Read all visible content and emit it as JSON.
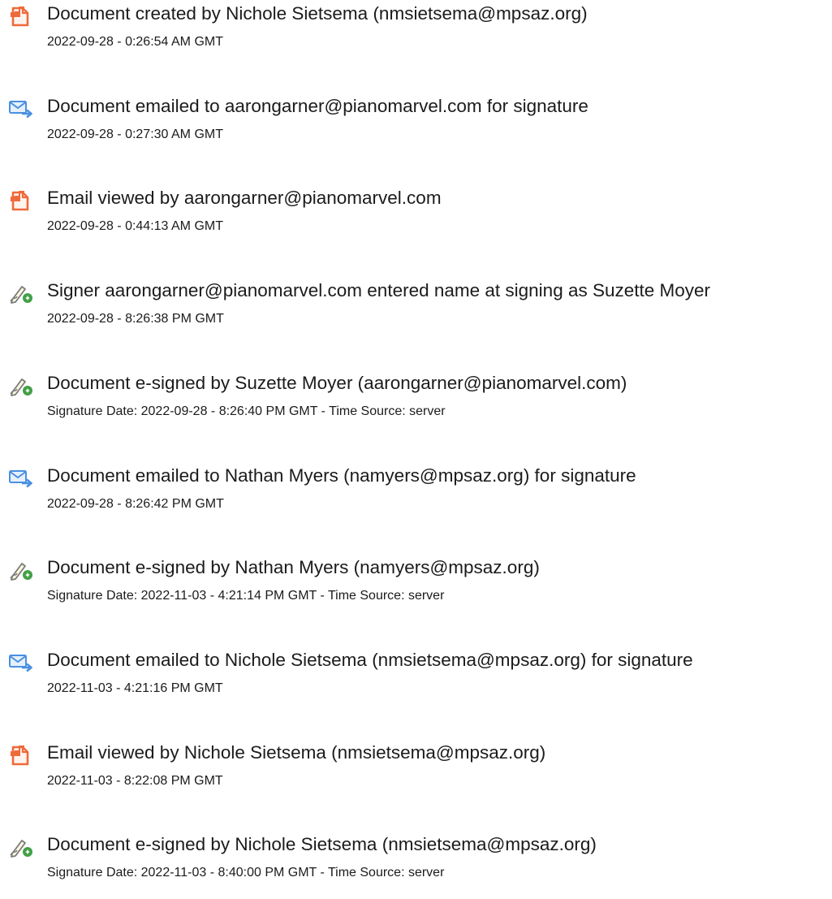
{
  "events": [
    {
      "icon": "document-created-icon",
      "title": "Document created by Nichole Sietsema (nmsietsema@mpsaz.org)",
      "time": "2022-09-28 - 0:26:54 AM GMT"
    },
    {
      "icon": "email-sent-icon",
      "title": "Document emailed to aarongarner@pianomarvel.com for signature",
      "time": "2022-09-28 - 0:27:30 AM GMT"
    },
    {
      "icon": "document-viewed-icon",
      "title": "Email viewed by aarongarner@pianomarvel.com",
      "time": "2022-09-28 - 0:44:13 AM GMT"
    },
    {
      "icon": "signature-pen-icon",
      "title": "Signer aarongarner@pianomarvel.com entered name at signing as Suzette Moyer",
      "time": "2022-09-28 - 8:26:38 PM GMT"
    },
    {
      "icon": "signature-pen-icon",
      "title": "Document e-signed by Suzette Moyer (aarongarner@pianomarvel.com)",
      "time": "Signature Date: 2022-09-28 - 8:26:40 PM GMT - Time Source: server"
    },
    {
      "icon": "email-sent-icon",
      "title": "Document emailed to Nathan Myers (namyers@mpsaz.org) for signature",
      "time": "2022-09-28 - 8:26:42 PM GMT"
    },
    {
      "icon": "signature-pen-icon",
      "title": "Document e-signed by Nathan Myers (namyers@mpsaz.org)",
      "time": "Signature Date: 2022-11-03 - 4:21:14 PM GMT - Time Source: server"
    },
    {
      "icon": "email-sent-icon",
      "title": "Document emailed to Nichole Sietsema (nmsietsema@mpsaz.org) for signature",
      "time": "2022-11-03 - 4:21:16 PM GMT"
    },
    {
      "icon": "document-viewed-icon",
      "title": "Email viewed by Nichole Sietsema (nmsietsema@mpsaz.org)",
      "time": "2022-11-03 - 8:22:08 PM GMT"
    },
    {
      "icon": "signature-pen-icon",
      "title": "Document e-signed by Nichole Sietsema (nmsietsema@mpsaz.org)",
      "time": "Signature Date: 2022-11-03 - 8:40:00 PM GMT - Time Source: server"
    }
  ],
  "colors": {
    "text": "#1b1b1b",
    "document_icon": "#ef6a3a",
    "email_icon": "#4a90e2",
    "signature_icon": "#43a047"
  }
}
